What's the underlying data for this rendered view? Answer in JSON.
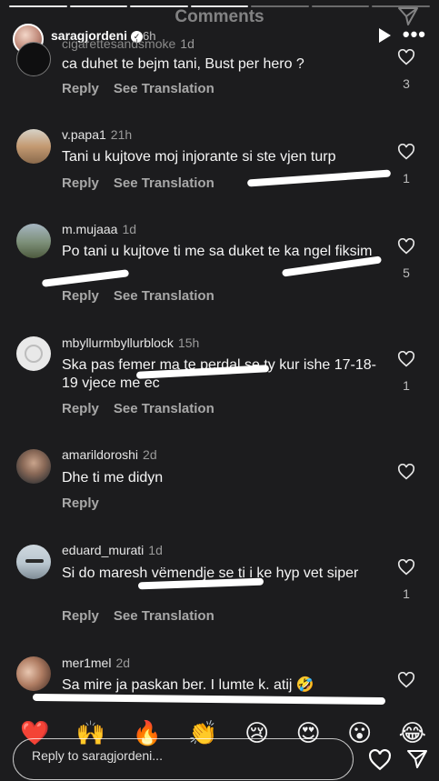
{
  "header": {
    "title": "Comments",
    "username": "saragjordeni",
    "time": "6h"
  },
  "comments": [
    {
      "username": "cigarettesandsmoke",
      "time": "1d",
      "text": "ca duhet te bejm tani, Bust per hero ?",
      "reply": "Reply",
      "translate": "See Translation",
      "likes": "3"
    },
    {
      "username": "v.papa1",
      "time": "21h",
      "text": "Tani u kujtove moj injorante si ste vjen turp",
      "reply": "Reply",
      "translate": "See Translation",
      "likes": "1"
    },
    {
      "username": "m.mujaaa",
      "time": "1d",
      "text": "Po tani u kujtove ti me sa duket te ka ngel fiksim",
      "reply": "Reply",
      "translate": "See Translation",
      "likes": "5"
    },
    {
      "username": "mbyllurmbyllurblock",
      "time": "15h",
      "text": "Ska pas femer ma te perdal se ty kur ishe 17-18-19 vjece me ec",
      "reply": "Reply",
      "translate": "See Translation",
      "likes": "1"
    },
    {
      "username": "amarildoroshi",
      "time": "2d",
      "text": "Dhe ti me didyn",
      "reply": "Reply",
      "translate": "",
      "likes": ""
    },
    {
      "username": "eduard_murati",
      "time": "1d",
      "text": "Si do maresh vëmendje se ti i ke hyp vet siper",
      "reply": "Reply",
      "translate": "See Translation",
      "likes": "1"
    },
    {
      "username": "mer1mel",
      "time": "2d",
      "text": "Sa mire ja paskan ber. I lumte k. atij 🤣",
      "reply": "",
      "translate": "",
      "likes": ""
    }
  ],
  "emojis": [
    "❤️",
    "🙌",
    "🔥",
    "👏",
    "😢",
    "😍",
    "😮",
    "😂"
  ],
  "reply_bar": {
    "placeholder": "Reply to saragjordeni..."
  }
}
